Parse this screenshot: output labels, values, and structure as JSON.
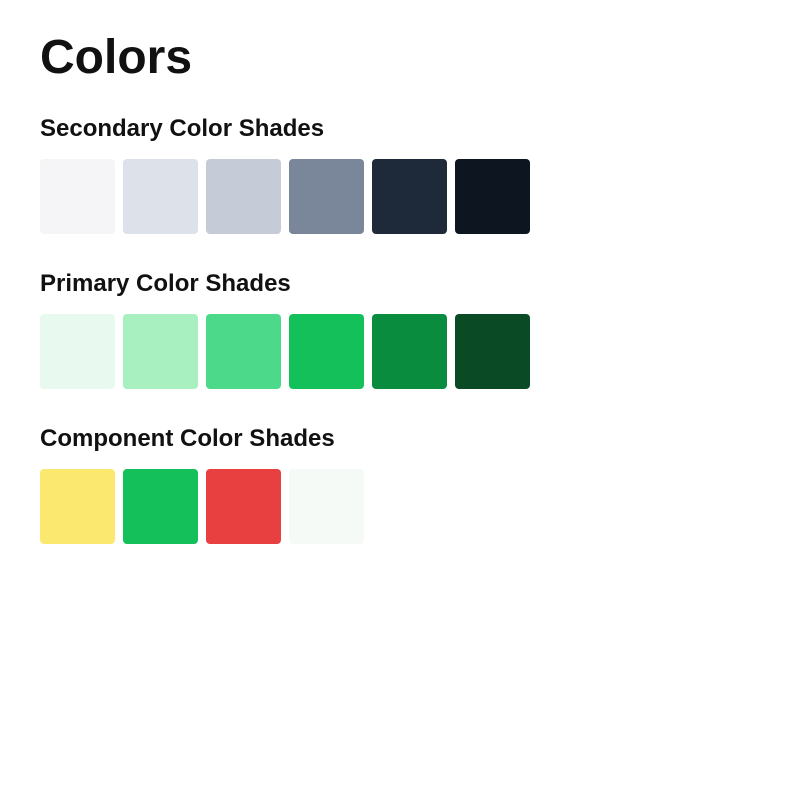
{
  "page": {
    "title": "Colors"
  },
  "sections": [
    {
      "id": "secondary",
      "label": "Secondary Color Shades",
      "swatches": [
        {
          "id": "s1",
          "color": "#f5f5f7"
        },
        {
          "id": "s2",
          "color": "#dde1e9"
        },
        {
          "id": "s3",
          "color": "#c5ccd8"
        },
        {
          "id": "s4",
          "color": "#7a8699"
        },
        {
          "id": "s5",
          "color": "#1e2a3a"
        },
        {
          "id": "s6",
          "color": "#0d1520"
        }
      ]
    },
    {
      "id": "primary",
      "label": "Primary Color Shades",
      "swatches": [
        {
          "id": "p1",
          "color": "#e8faf0"
        },
        {
          "id": "p2",
          "color": "#a8f0c0"
        },
        {
          "id": "p3",
          "color": "#4dd98a"
        },
        {
          "id": "p4",
          "color": "#14c05a"
        },
        {
          "id": "p5",
          "color": "#0a8c3f"
        },
        {
          "id": "p6",
          "color": "#0a4a25"
        }
      ]
    },
    {
      "id": "component",
      "label": "Component Color Shades",
      "swatches": [
        {
          "id": "c1",
          "color": "#fae96e"
        },
        {
          "id": "c2",
          "color": "#14c05a"
        },
        {
          "id": "c3",
          "color": "#e84040"
        },
        {
          "id": "c4",
          "color": "#f5faf7"
        }
      ]
    }
  ]
}
